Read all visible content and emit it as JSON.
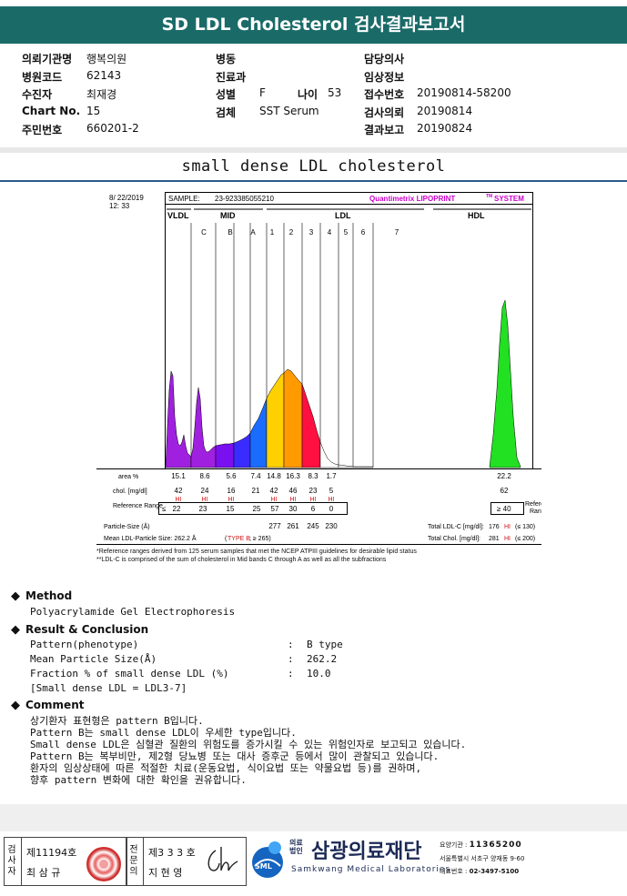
{
  "header": {
    "title": "SD LDL Cholesterol 검사결과보고서"
  },
  "info": {
    "hospital_label": "의뢰기관명",
    "hospital": "행복의원",
    "code_label": "병원코드",
    "code": "62143",
    "patient_label": "수진자",
    "patient": "최재경",
    "chart_label": "Chart No.",
    "chart": "15",
    "id_label": "주민번호",
    "id": "660201-2",
    "ward_label": "병동",
    "ward": "",
    "dept_label": "진료과",
    "dept": "",
    "sex_label": "성별",
    "sex": "F",
    "age_label": "나이",
    "age": "53",
    "specimen_label": "검체",
    "specimen": "SST Serum",
    "doctor_label": "담당의사",
    "doctor": "",
    "clinical_label": "임상정보",
    "clinical": "",
    "receipt_label": "접수번호",
    "receipt": "20190814-58200",
    "request_label": "검사의뢰",
    "request": "20190814",
    "report_label": "결과보고",
    "report": "20190824"
  },
  "section_title": "small dense LDL cholesterol",
  "chart_data": {
    "type": "area",
    "date": "8/ 22/2019",
    "time": "12: 33",
    "sample_label": "SAMPLE:",
    "sample": "23-923385055210",
    "system": "Quantimetrix LIPOPRINT",
    "system_tm": "TM",
    "system_suffix": "SYSTEM",
    "groups": [
      "VLDL",
      "MID",
      "LDL",
      "HDL"
    ],
    "bands": [
      "C",
      "B",
      "A",
      "1",
      "2",
      "3",
      "4",
      "5",
      "6",
      "7"
    ],
    "row_labels": [
      "area %",
      "chol. [mg/dl]",
      "Reference Range",
      "Particle-Size (Å)"
    ],
    "area": [
      "15.1",
      "8.6",
      "5.6",
      "7.4",
      "14.8",
      "16.3",
      "8.3",
      "1.7",
      "22.2"
    ],
    "chol": [
      "42",
      "24",
      "16",
      "21",
      "42",
      "46",
      "23",
      "5",
      "62"
    ],
    "chol_flags": [
      "HI",
      "HI",
      "HI",
      "",
      "HI",
      "HI",
      "HI",
      "HI",
      ""
    ],
    "ref_prefix": "≤",
    "ref": [
      "22",
      "23",
      "15",
      "25",
      "57",
      "30",
      "6",
      "0"
    ],
    "hdl_ref": "≥ 40",
    "particle_size": [
      "277",
      "261",
      "245",
      "230"
    ],
    "mean_size": "Mean LDL-Particle Size:  262.2 Å",
    "type_text": "TYPE B",
    "type_ref": "≥ 265",
    "total_ldl_label": "Total LDL-C [mg/dl]:",
    "total_ldl": "176",
    "total_ldl_ref": "≤ 130",
    "total_chol_label": "Total Chol. [mg/dl]:",
    "total_chol": "281",
    "total_chol_ref": "≤ 200",
    "hi": "HI",
    "ref_label": "Reference Range",
    "colors": {
      "vldl": "#a020e0",
      "mid": "#7a10f0",
      "ldl1": "#1a6cff",
      "ldl2": "#ffd000",
      "ldl3": "#ff9a00",
      "ldl4": "#ff1040",
      "hdl": "#22e022",
      "magenta": "#cc00cc"
    }
  },
  "notes": {
    "n1": "*Reference ranges derived from 125 serum samples that met the NCEP ATPIII guidelines for desirable lipid status",
    "n2": "**LDL-C is comprised of the sum of cholesterol in Mid bands C through A as well as all the subfractions"
  },
  "method": {
    "head": "Method",
    "body": "Polyacrylamide Gel Electrophoresis"
  },
  "result": {
    "head": "Result & Conclusion",
    "rows": [
      {
        "k": "Pattern(phenotype)",
        "v": "B type"
      },
      {
        "k": "Mean Particle Size(Å)",
        "v": "262.2"
      },
      {
        "k": "Fraction % of small dense LDL (%)",
        "v": "10.0"
      }
    ],
    "formula": "[Small dense LDL = LDL3-7]",
    "sep": ":"
  },
  "comment": {
    "head": "Comment",
    "lines": [
      "상기환자 표현형은 pattern B입니다.",
      "Pattern B는 small dense LDL이 우세한 type입니다.",
      "Small dense LDL은 심혈관 질환의 위험도를 증가시킬 수 있는 위험인자로 보고되고 있습니다.",
      "Pattern B는 복부비만, 제2형 당뇨병 또는 대사 증후군 등에서 많이 관찰되고 있습니다.",
      "환자의 임상상태에 따른 적절한 치료(운동요법, 식이요법 또는 약물요법 등)를 권하며,",
      "향후 pattern 변화에 대한 확인을 권유합니다."
    ]
  },
  "footer": {
    "tester_vert": "검사자",
    "tester_no": "제11194호",
    "tester_name": "최 삼 규",
    "doctor_vert": "전문의",
    "doctor_no": "제3 3 3 호",
    "doctor_name": "지 현 영",
    "org_small": "의료법인",
    "org": "삼광의료재단",
    "org_en": "Samkwang Medical Laboratories",
    "logo": "SML",
    "agency_label": "요양기관 :",
    "agency": "11365200",
    "address": "서울특별시 서초구 양재동 9-60",
    "phone_label": "대표번호 :",
    "phone": "02-3497-5100"
  }
}
